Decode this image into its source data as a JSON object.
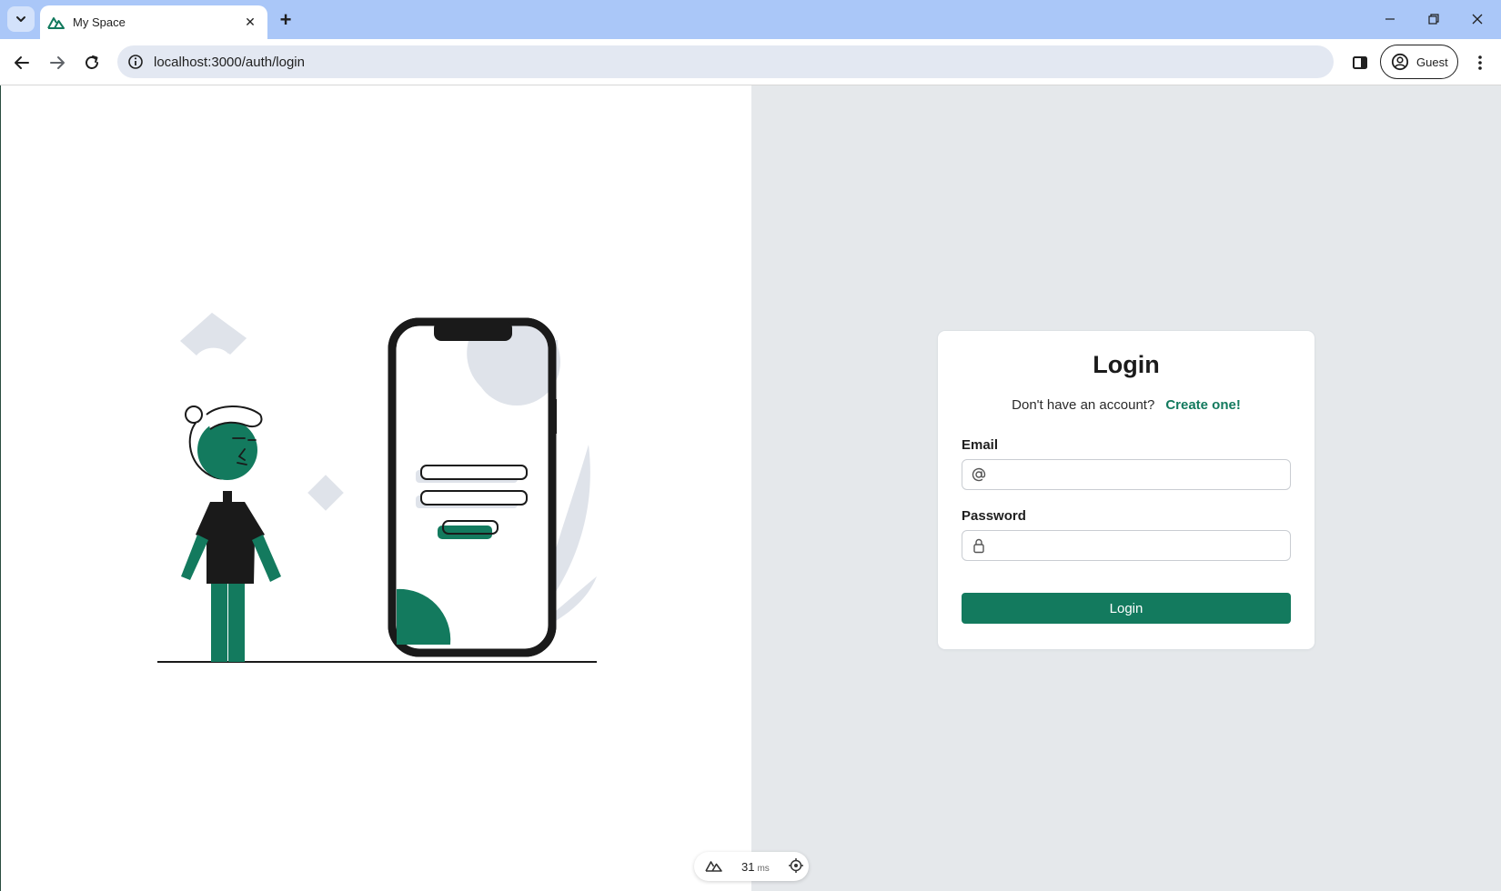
{
  "browser": {
    "tab": {
      "title": "My Space",
      "favicon": "nuxt-logo-icon"
    },
    "omnibox": {
      "url": "localhost:3000/auth/login"
    },
    "profile": {
      "label": "Guest"
    }
  },
  "login_card": {
    "title": "Login",
    "signup_prompt": "Don't have an account?",
    "signup_link": "Create one!",
    "email_label": "Email",
    "email_value": "",
    "email_icon": "at-sign-icon",
    "password_label": "Password",
    "password_value": "",
    "password_icon": "lock-icon",
    "submit_label": "Login"
  },
  "devtools": {
    "render_time": "31",
    "render_unit": "ms"
  },
  "colors": {
    "accent": "#137a5e",
    "tabstrip": "#aac7f8",
    "right_pane_bg": "#e5e8eb",
    "illustration_dark": "#1a1a1a",
    "illustration_light": "#dfe3ea"
  }
}
